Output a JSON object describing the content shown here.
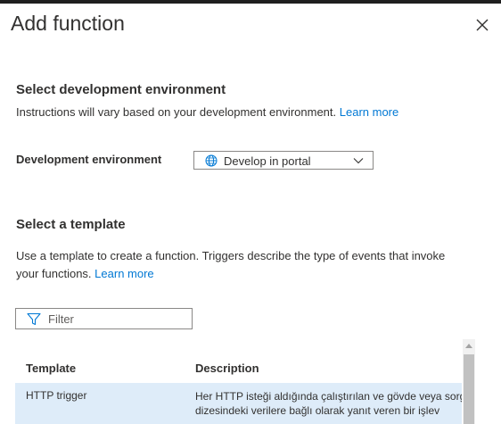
{
  "panel": {
    "title": "Add function",
    "close_icon": "close-icon"
  },
  "dev_env": {
    "heading": "Select development environment",
    "description": "Instructions will vary based on your development environment.",
    "learn_more": "Learn more",
    "field_label": "Development environment",
    "selected": "Develop in portal",
    "icon": "globe-icon"
  },
  "template": {
    "heading": "Select a template",
    "description_line1": "Use a template to create a function. Triggers describe the type of events that invoke",
    "description_line2": "your functions.",
    "learn_more": "Learn more",
    "filter_placeholder": "Filter",
    "columns": [
      "Template",
      "Description"
    ],
    "rows": [
      {
        "name": "HTTP trigger",
        "description_line1": "Her HTTP isteği aldığında çalıştırılan ve gövde veya sorgu",
        "description_line2": "dizesindeki verilere bağlı olarak yanıt veren bir işlev"
      }
    ]
  },
  "colors": {
    "accent": "#0078d4",
    "selected_row": "#deecf9",
    "text": "#323130"
  }
}
